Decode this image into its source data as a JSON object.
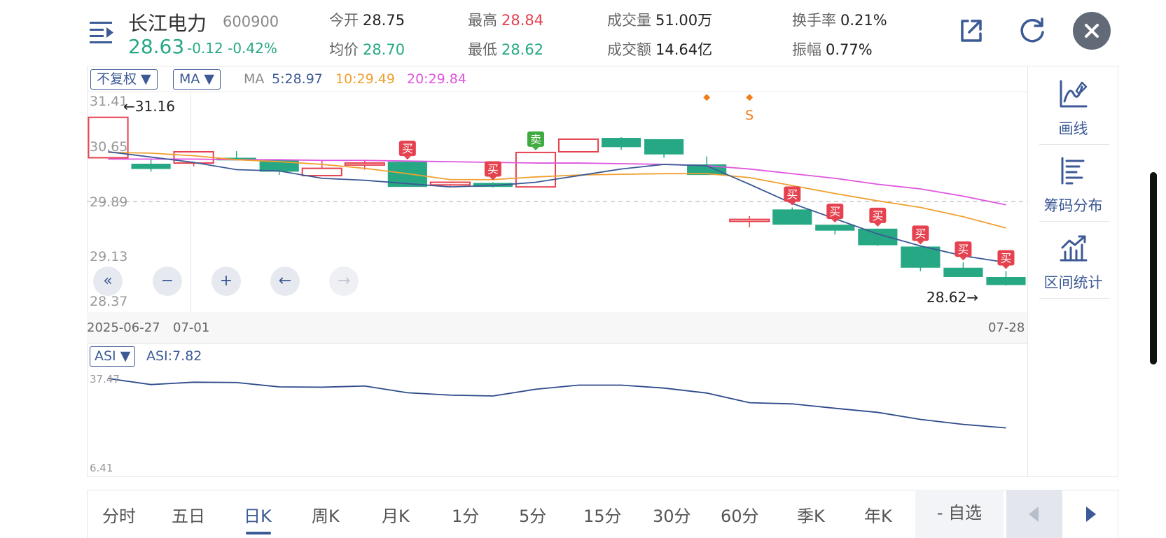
{
  "header": {
    "name": "长江电力",
    "code": "600900",
    "price": "28.63",
    "change": "-0.12",
    "change_pct": "-0.42%",
    "stats": {
      "open_label": "今开",
      "open": "28.75",
      "high_label": "最高",
      "high": "28.84",
      "volume_label": "成交量",
      "volume": "51.00万",
      "turnover_label": "换手率",
      "turnover": "0.21%",
      "avg_label": "均价",
      "avg": "28.70",
      "low_label": "最低",
      "low": "28.62",
      "amount_label": "成交额",
      "amount": "14.64亿",
      "amplitude_label": "振幅",
      "amplitude": "0.77%"
    }
  },
  "toolbar": {
    "adjust": "不复权 ▼",
    "indicator": "MA ▼",
    "ma_label": "MA",
    "ma5": "5:28.97",
    "ma10": "10:29.49",
    "ma20": "20:29.84"
  },
  "colors": {
    "up": "#e5414e",
    "down": "#26a884",
    "ma5": "#3c5a96",
    "ma10": "#f0a030",
    "ma20": "#e055e0",
    "asi": "#2d4a8a"
  },
  "axis": {
    "y_labels": [
      "31.41",
      "30.65",
      "29.89",
      "29.13",
      "28.37"
    ],
    "max_marker": "←31.16",
    "min_marker": "28.62→",
    "dates": {
      "start": "2025-06-27",
      "mid": "07-01",
      "end": "07-28"
    }
  },
  "asi": {
    "dropdown": "ASI ▼",
    "value": "ASI:7.82",
    "top": "37.47",
    "bottom": "6.41"
  },
  "controls": [
    "«",
    "−",
    "+",
    "←",
    "→"
  ],
  "tools": [
    {
      "label": "画线",
      "icon": "draw-line-icon"
    },
    {
      "label": "筹码分布",
      "icon": "chip-distribution-icon"
    },
    {
      "label": "区间统计",
      "icon": "range-stats-icon"
    }
  ],
  "tabs": [
    "分时",
    "五日",
    "日K",
    "周K",
    "月K",
    "1分",
    "5分",
    "15分",
    "30分",
    "60分",
    "季K",
    "年K"
  ],
  "active_tab": "日K",
  "fav_button": "- 自选",
  "signals": {
    "buy": "买",
    "sell": "卖",
    "s": "S"
  },
  "chart_data": {
    "type": "candlestick",
    "y_range": [
      28.37,
      31.41
    ],
    "candles": [
      {
        "o": 30.55,
        "h": 31.16,
        "l": 30.55,
        "c": 31.16
      },
      {
        "o": 30.46,
        "h": 30.52,
        "l": 30.34,
        "c": 30.38
      },
      {
        "o": 30.47,
        "h": 30.62,
        "l": 30.42,
        "c": 30.64
      },
      {
        "o": 30.55,
        "h": 30.65,
        "l": 30.51,
        "c": 30.51
      },
      {
        "o": 30.52,
        "h": 30.52,
        "l": 30.29,
        "c": 30.34
      },
      {
        "o": 30.28,
        "h": 30.51,
        "l": 30.27,
        "c": 30.39
      },
      {
        "o": 30.44,
        "h": 30.51,
        "l": 30.37,
        "c": 30.47
      },
      {
        "o": 30.49,
        "h": 30.49,
        "l": 30.15,
        "c": 30.11
      },
      {
        "o": 30.14,
        "h": 30.15,
        "l": 30.12,
        "c": 30.18
      },
      {
        "o": 30.17,
        "h": 30.18,
        "l": 30.1,
        "c": 30.11
      },
      {
        "o": 30.11,
        "h": 30.11,
        "l": 30.11,
        "c": 30.63
      },
      {
        "o": 30.64,
        "h": 30.64,
        "l": 30.64,
        "c": 30.83
      },
      {
        "o": 30.85,
        "h": 30.86,
        "l": 30.67,
        "c": 30.71
      },
      {
        "o": 30.83,
        "h": 30.83,
        "l": 30.55,
        "c": 30.6
      },
      {
        "o": 30.45,
        "h": 30.57,
        "l": 30.31,
        "c": 30.29
      },
      {
        "o": 29.59,
        "h": 29.67,
        "l": 29.5,
        "c": 29.62
      },
      {
        "o": 29.77,
        "h": 29.8,
        "l": 29.55,
        "c": 29.54
      },
      {
        "o": 29.54,
        "h": 29.54,
        "l": 29.39,
        "c": 29.45
      },
      {
        "o": 29.48,
        "h": 29.48,
        "l": 29.22,
        "c": 29.23
      },
      {
        "o": 29.21,
        "h": 29.21,
        "l": 28.84,
        "c": 28.89
      },
      {
        "o": 28.89,
        "h": 28.97,
        "l": 28.83,
        "c": 28.75
      },
      {
        "o": 28.75,
        "h": 28.84,
        "l": 28.62,
        "c": 28.63
      }
    ],
    "ma5": [
      30.64,
      30.56,
      30.48,
      30.37,
      30.35,
      30.24,
      30.21,
      30.16,
      30.11,
      30.13,
      30.18,
      30.28,
      30.38,
      30.45,
      30.43,
      30.15,
      29.86,
      29.63,
      29.4,
      29.22,
      29.07,
      28.97
    ],
    "ma10": [
      30.63,
      30.62,
      30.58,
      30.52,
      30.49,
      30.45,
      30.39,
      30.31,
      30.22,
      30.22,
      30.26,
      30.29,
      30.3,
      30.31,
      30.31,
      30.25,
      30.13,
      30.01,
      29.9,
      29.8,
      29.66,
      29.49
    ],
    "ma20": [
      30.53,
      30.53,
      30.53,
      30.52,
      30.52,
      30.51,
      30.51,
      30.5,
      30.49,
      30.48,
      30.47,
      30.47,
      30.46,
      30.45,
      30.43,
      30.38,
      30.31,
      30.24,
      30.15,
      30.08,
      29.97,
      29.84
    ],
    "buy_signals": [
      7,
      9,
      16,
      17,
      18,
      19,
      20,
      21
    ],
    "sell_signals": [
      10
    ],
    "asi_values": [
      37.47,
      35.4,
      36.2,
      36.1,
      34.6,
      34.5,
      34.9,
      32.6,
      31.8,
      31.5,
      33.8,
      35.2,
      35.2,
      34.2,
      32.5,
      29.2,
      28.8,
      27.3,
      25.9,
      23.5,
      21.8,
      20.6
    ]
  }
}
